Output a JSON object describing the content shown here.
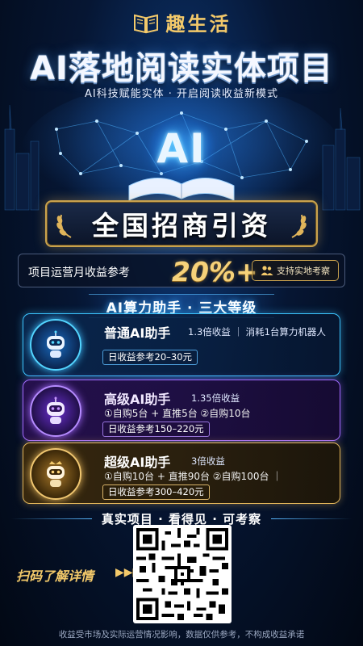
{
  "header": {
    "brand_name": "趣生活",
    "title": "AI落地阅读实体项目",
    "subtitle": "AI科技赋能实体 · 开启阅读收益新模式"
  },
  "hero": {
    "ai_text": "AI"
  },
  "banner": {
    "text": "全国招商引资"
  },
  "revenue": {
    "label": "项目运营月收益参考",
    "value": "20%+",
    "visit_button": "支持实地考察"
  },
  "tiers_section": {
    "title": "AI算力助手 · 三大等级",
    "tiers": [
      {
        "name": "普通AI助手",
        "meta": "1.3倍收益 ｜ 消耗1台算力机器人",
        "desc": "",
        "daily": "日收益参考20–30元"
      },
      {
        "name": "高级AI助手",
        "meta": "1.35倍收益",
        "desc": "①自购5台 + 直推5台 ②自购10台",
        "daily": "日收益参考150–220元"
      },
      {
        "name": "超级AI助手",
        "meta": "3倍收益",
        "desc": "①自购10台 + 直推90台 ②自购100台 ｜",
        "daily": "日收益参考300–420元"
      }
    ]
  },
  "footer": {
    "headline": "真实项目 · 看得见 · 可考察",
    "scan_label": "扫码了解详情",
    "scan_arrow": "▶▶▶",
    "disclaimer": "收益受市场及实际运营情况影响，数据仅供参考，不构成收益承诺"
  },
  "colors": {
    "gold": "#f3c96a",
    "tier_blue": "#3cc6ff",
    "tier_purple": "#a36bff",
    "tier_gold": "#e2b65a",
    "background": "#061633"
  },
  "icons": {
    "brand": "open-book-icon",
    "visit": "people-icon",
    "tier": "robot-icon",
    "banner": "laurel-icon"
  }
}
